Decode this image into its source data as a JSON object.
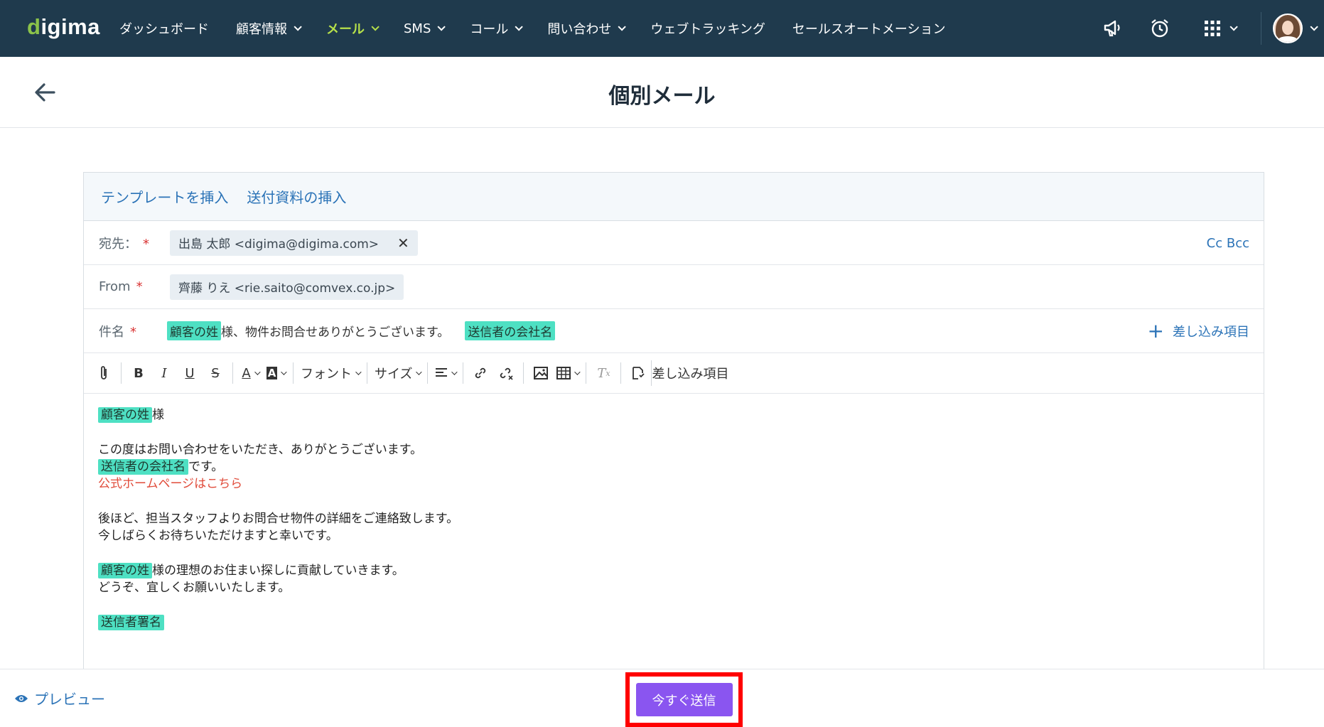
{
  "nav": {
    "logo_prefix": "d",
    "logo_rest": "igima",
    "items": [
      {
        "label": "ダッシュボード",
        "dropdown": false,
        "active": false
      },
      {
        "label": "顧客情報",
        "dropdown": true,
        "active": false
      },
      {
        "label": "メール",
        "dropdown": true,
        "active": true
      },
      {
        "label": "SMS",
        "dropdown": true,
        "active": false
      },
      {
        "label": "コール",
        "dropdown": true,
        "active": false
      },
      {
        "label": "問い合わせ",
        "dropdown": true,
        "active": false
      },
      {
        "label": "ウェブトラッキング",
        "dropdown": false,
        "active": false
      },
      {
        "label": "セールスオートメーション",
        "dropdown": false,
        "active": false
      }
    ],
    "icons": [
      "megaphone-icon",
      "alarm-clock-icon",
      "apps-grid-icon",
      "avatar"
    ],
    "colors": {
      "bar": "#1f3a4d",
      "active": "#b6e04a"
    }
  },
  "header": {
    "title": "個別メール",
    "back_icon": "arrow-left-icon"
  },
  "compose": {
    "links": {
      "insert_template": "テンプレートを挿入",
      "insert_attachment": "送付資料の挿入"
    },
    "to": {
      "label": "宛先：",
      "required_mark": "*",
      "chip": "出島 太郎 <digima@digima.com>",
      "remove": "✕",
      "cc_bcc": "Cc Bcc"
    },
    "from": {
      "label": "From",
      "required_mark": "*",
      "chip": "齊藤 りえ <rie.saito@comvex.co.jp>"
    },
    "subject": {
      "label": "件名",
      "required_mark": "*",
      "tag1": "顧客の姓",
      "text": "様、物件お問合せありがとうございます。",
      "tag2": "送信者の会社名",
      "merge_plus": "+",
      "merge_label": "差し込み項目"
    },
    "toolbar": {
      "font_label": "フォント",
      "size_label": "サイズ",
      "merge_label": "差し込み項目"
    },
    "body": {
      "l1_tag": "顧客の姓",
      "l1_text": "様",
      "l3": "この度はお問い合わせをいただき、ありがとうございます。",
      "l4_tag": "送信者の会社名",
      "l4_text": "です。",
      "l5_link": "公式ホームページはこちら",
      "l7": "後ほど、担当スタッフよりお問合せ物件の詳細をご連絡致します。",
      "l8": "今しばらくお待ちいただけますと幸いです。",
      "l10_tag": "顧客の姓",
      "l10_text": "様の理想のお住まい探しに貢献していきます。",
      "l11": "どうぞ、宜しくお願いいたします。",
      "l13_tag": "送信者署名"
    },
    "colors": {
      "tag": "#4ee0c3",
      "link": "#2b73b7",
      "link_red": "#e04b3a"
    }
  },
  "footer": {
    "preview": "プレビュー",
    "send": "今すぐ送信",
    "send_color": "#8a55f0",
    "highlight_color": "#ff0000"
  }
}
